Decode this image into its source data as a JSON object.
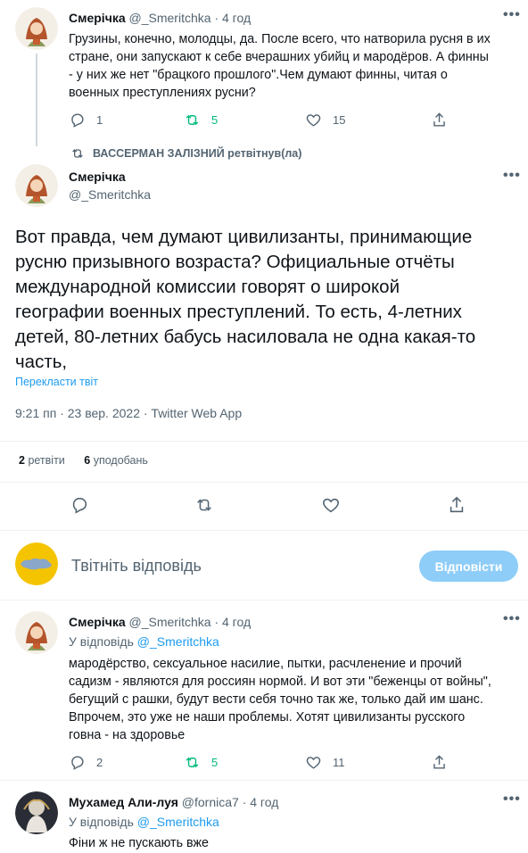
{
  "tweet1": {
    "name": "Смерічка",
    "handle": "@_Smeritchka",
    "sep": "·",
    "time": "4 год",
    "lines": [
      "Грузины, конечно, молодцы, да. После всего, что натворила русня в их",
      "стране, они запускают к себе вчерашних убийц и мародёров. А финны",
      "- у них же нет \"брацкого прошлого\".Чем думают финны, читая о",
      "военных преступлениях русни?"
    ],
    "replies": "1",
    "retweets": "5",
    "likes": "15"
  },
  "retweet_banner": {
    "text": "ВАССЕРМАН ЗАЛІЗНИЙ ретвітнув(ла)"
  },
  "main_tweet": {
    "name": "Смерічка",
    "handle": "@_Smeritchka",
    "lines": [
      "Вот правда, чем думают цивилизанты, принимающие",
      "русню призывного возраста? Официальные отчёты",
      "международной комиссии говорят о широкой",
      "географии военных преступлений. То есть, 4-летних",
      "детей, 80-летних бабусь насиловала не одна какая-то",
      "часть,"
    ],
    "translate": "Перекласти твіт",
    "timestamp": "9:21 пп · 23 вер. 2022 · Twitter Web App",
    "retweet_count": "2",
    "retweet_label": "ретвіти",
    "like_count": "6",
    "like_label": "уподобань"
  },
  "compose": {
    "placeholder": "Твітніть відповідь",
    "button": "Відповісти"
  },
  "reply1": {
    "name": "Смерічка",
    "handle": "@_Smeritchka",
    "sep": "·",
    "time": "4 год",
    "reply_to_label": "У відповідь",
    "reply_to_handle": "@_Smeritchka",
    "lines": [
      "мародёрство, сексуальное насилие, пытки, расчленение и прочий",
      "садизм - являются для россиян нормой. И вот эти \"беженцы от войны\",",
      "бегущий с рашки, будут вести себя точно так же, только дай им шанс.",
      "Впрочем, это уже не наши проблемы. Хотят цивилизанты русского",
      "говна - на здоровье"
    ],
    "replies": "2",
    "retweets": "5",
    "likes": "11"
  },
  "reply2": {
    "name": "Мухамед Али-луя",
    "handle": "@fornica7",
    "sep": "·",
    "time": "4 год",
    "reply_to_label": "У відповідь",
    "reply_to_handle": "@_Smeritchka",
    "lines": [
      "Фіни ж не пускають вже"
    ]
  },
  "colors": {
    "accent": "#1d9bf0",
    "retweet_green": "#00ba7c",
    "muted": "#536471",
    "reply_button": "#8ecdf8",
    "compose_avatar": "#f4c400"
  }
}
